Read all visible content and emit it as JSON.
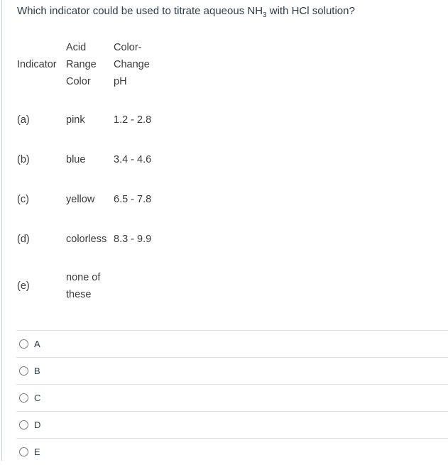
{
  "question": {
    "prefix": "Which indicator could be used to titrate aqueous NH",
    "subscript": "3",
    "suffix": " with HCl solution?"
  },
  "table": {
    "headers": {
      "indicator": "Indicator",
      "acid_range_color": [
        "Acid",
        "Range",
        "Color"
      ],
      "color_change_ph": [
        "Color-",
        "Change",
        "pH"
      ]
    },
    "rows": [
      {
        "label": "(a)",
        "color": "pink",
        "ph": "1.2 - 2.8"
      },
      {
        "label": "(b)",
        "color": "blue",
        "ph": "3.4 - 4.6"
      },
      {
        "label": "(c)",
        "color": "yellow",
        "ph": "6.5 - 7.8"
      },
      {
        "label": "(d)",
        "color": "colorless",
        "ph": "8.3 - 9.9"
      },
      {
        "label": "(e)",
        "color_lines": [
          "none of",
          "these"
        ],
        "ph": ""
      }
    ]
  },
  "options": [
    {
      "label": "A",
      "selected": false
    },
    {
      "label": "B",
      "selected": false
    },
    {
      "label": "C",
      "selected": false
    },
    {
      "label": "D",
      "selected": false
    },
    {
      "label": "E",
      "selected": false
    }
  ]
}
